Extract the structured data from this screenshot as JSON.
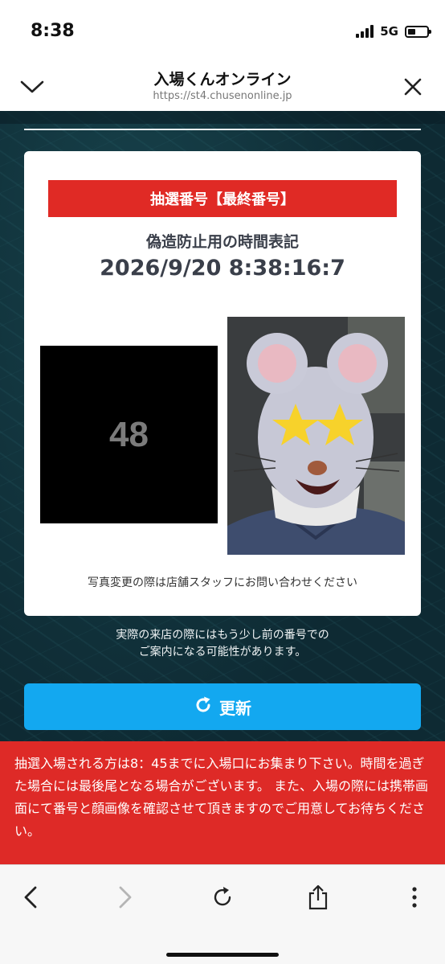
{
  "status": {
    "time": "8:38",
    "network": "5G"
  },
  "browser": {
    "title": "入場くんオンライン",
    "url": "https://st4.chusenonline.jp"
  },
  "card": {
    "banner": "抽選番号【最終番号】",
    "anti_forgery_label": "偽造防止用の時間表記",
    "timestamp": "2026/9/20 8:38:16:7",
    "number": "48",
    "photo_note": "写真変更の際は店舗スタッフにお問い合わせください"
  },
  "notice": {
    "line1": "実際の来店の際にはもう少し前の番号での",
    "line2": "ご案内になる可能性があります。"
  },
  "refresh_button": {
    "label": "更新"
  },
  "alert": {
    "text": "抽選入場される方は8：45までに入場口にお集まり下さい。時間を過ぎた場合には最後尾となる場合がございます。 また、入場の際には携帯画面にて番号と顔画像を確認させて頂きますのでご用意してお待ちください。"
  },
  "icons": {
    "chevron_down": "chevron-down-icon",
    "close": "close-icon",
    "back": "back-icon",
    "forward": "forward-icon",
    "reload": "reload-icon",
    "share": "share-icon",
    "more": "more-icon",
    "refresh": "refresh-icon"
  },
  "colors": {
    "banner_red": "#e02a25",
    "alert_red": "#de2a27",
    "button_blue": "#13a8f0",
    "background": "#0e2a33"
  }
}
